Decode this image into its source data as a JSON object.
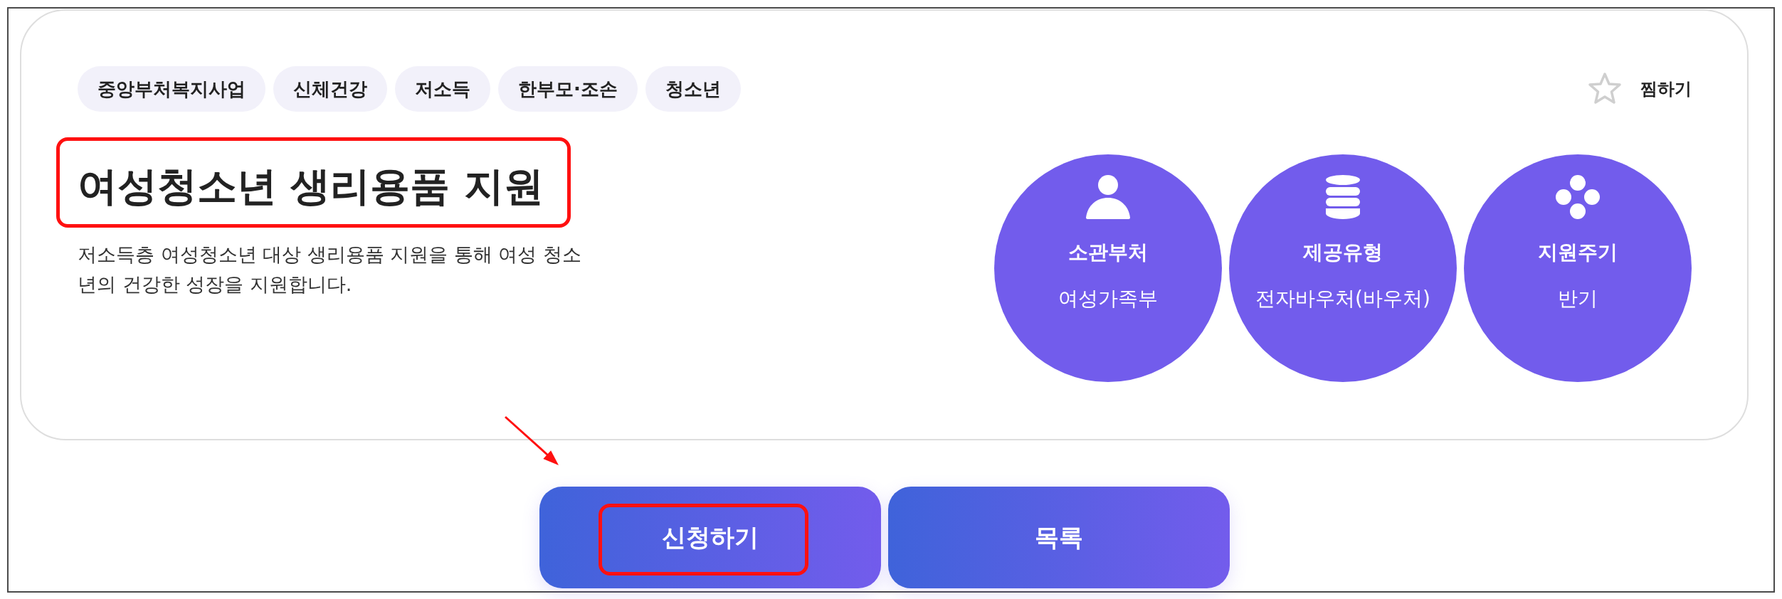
{
  "tags": [
    "중앙부처복지사업",
    "신체건강",
    "저소득",
    "한부모·조손",
    "청소년"
  ],
  "favorite": {
    "label": "찜하기",
    "selected": false
  },
  "title": {
    "text": "여성청소년 생리용품 지원",
    "highlighted": true
  },
  "description": "저소득층 여성청소년 대상 생리용품 지원을 통해 여성 청소년의 건강한 성장을 지원합니다.",
  "info": [
    {
      "kind": "department",
      "heading": "소관부처",
      "value": "여성가족부"
    },
    {
      "kind": "provision_type",
      "heading": "제공유형",
      "value": "전자바우처(바우처)"
    },
    {
      "kind": "cycle",
      "heading": "지원주기",
      "value": "반기"
    }
  ],
  "buttons": [
    {
      "label": "신청하기",
      "highlighted": true
    },
    {
      "label": "목록",
      "highlighted": false
    }
  ]
}
